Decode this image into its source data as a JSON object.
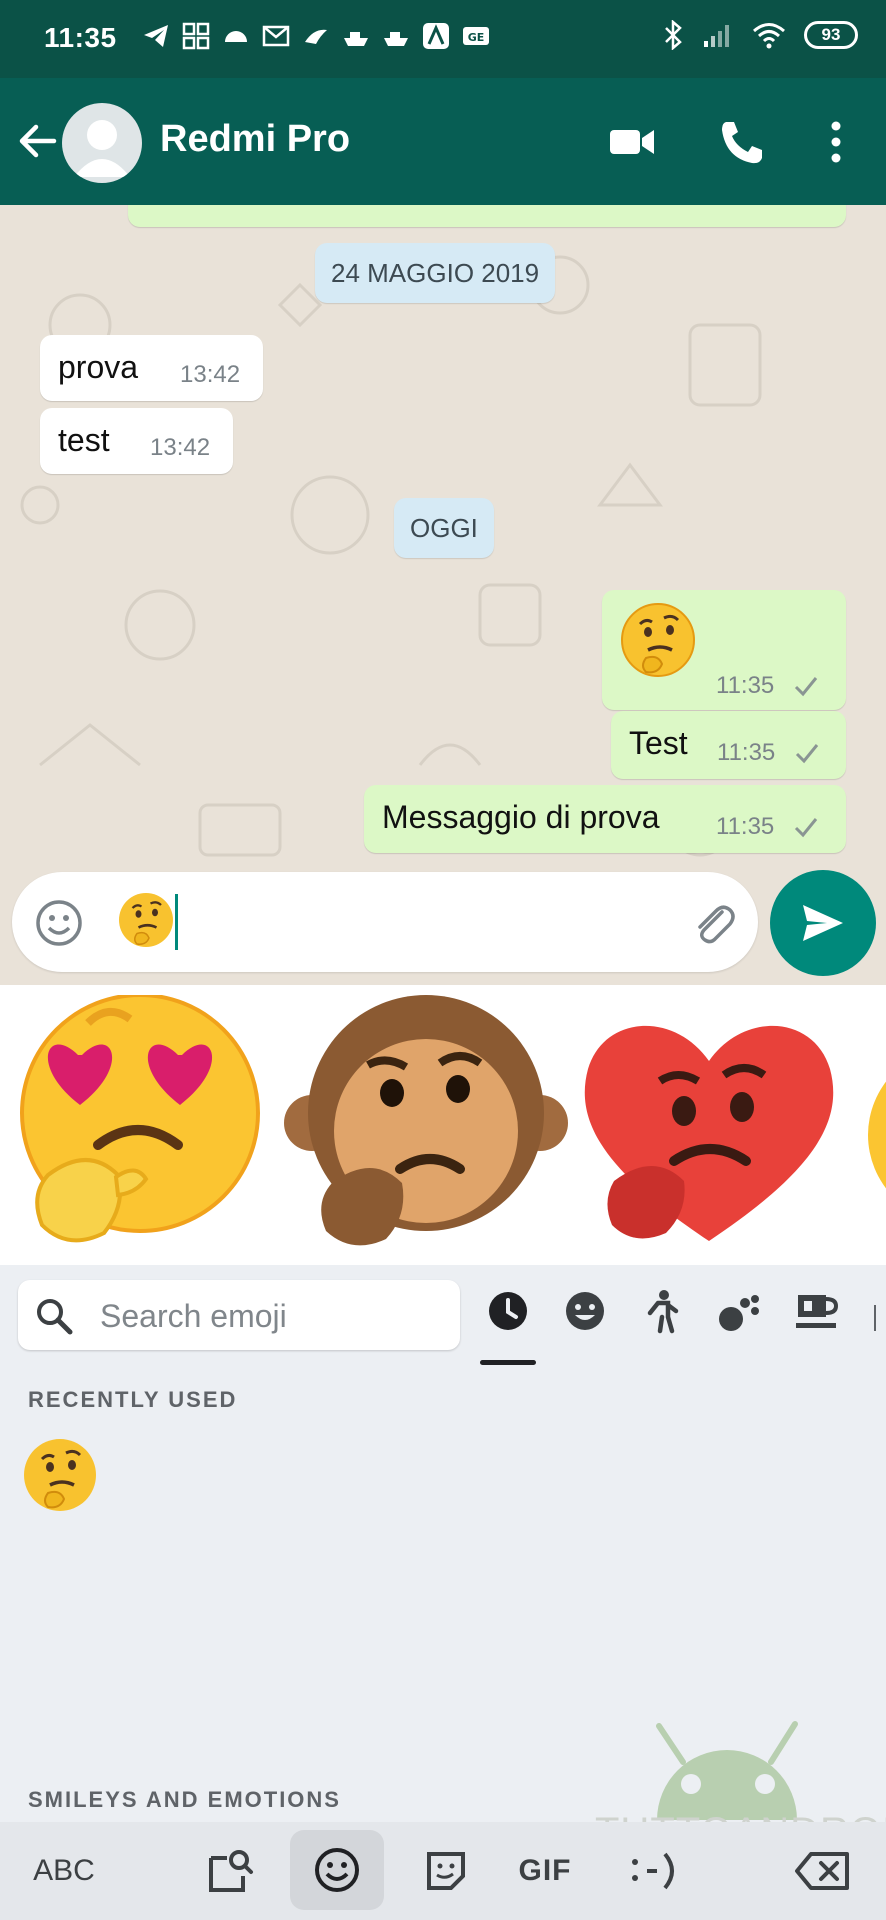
{
  "status_bar": {
    "time": "11:35",
    "battery": "93"
  },
  "contact": {
    "name": "Redmi Pro"
  },
  "chat": {
    "dates": [
      "24 MAGGIO 2019",
      "OGGI"
    ],
    "incoming": [
      {
        "text": "prova",
        "time": "13:42"
      },
      {
        "text": "test",
        "time": "13:42"
      }
    ],
    "outgoing": [
      {
        "emoji": "🤔",
        "time": "11:35"
      },
      {
        "text": "Test",
        "time": "11:35"
      },
      {
        "text": "Messaggio di prova",
        "time": "11:35"
      }
    ]
  },
  "composer": {
    "typed_emoji": "🤔"
  },
  "keyboard": {
    "search_placeholder": "Search emoji",
    "sections": [
      "RECENTLY USED",
      "SMILEYS AND EMOTIONS"
    ],
    "recent": [
      "🤔"
    ],
    "bottom_bar": {
      "abc": "ABC",
      "gif": "GIF"
    }
  },
  "watermark": "TUTTOANDROID",
  "colors": {
    "header": "#075e54",
    "status": "#0b5247",
    "accent": "#00897b",
    "outgoing_bubble": "#dcf8c6"
  }
}
